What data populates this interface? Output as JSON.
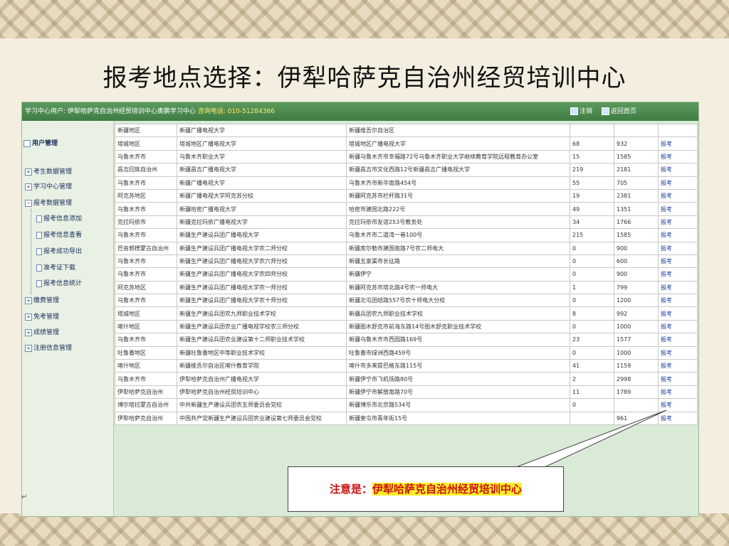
{
  "slide": {
    "title": "报考地点选择：伊犁哈萨克自治州经贸培训中心"
  },
  "topbar": {
    "user_text": "学习中心用户: 伊犁哈萨克自治州经贸培训中心奥鹏学习中心",
    "phone_label": "咨询电话: 010-51284366",
    "logout": "注销",
    "home": "返回首页"
  },
  "sidebar": {
    "header": "用户管理",
    "items": [
      "考生数据管理",
      "学习中心管理",
      "报考数据管理",
      "报考信息添加",
      "报考信息查看",
      "报考成功导出",
      "准考证下载",
      "报考信息统计",
      "缴费管理",
      "免考管理",
      "成绩管理",
      "注册信息管理"
    ]
  },
  "table": {
    "rows": [
      [
        "新疆地区",
        "新疆广播电视大学",
        "新疆维吾尔自治区",
        "",
        "",
        ""
      ],
      [
        "塔城地区",
        "塔城地区广播电视大学",
        "塔城地区广播电视大学",
        "68",
        "932",
        "报考"
      ],
      [
        "乌鲁木齐市",
        "乌鲁木齐职业大学",
        "新疆乌鲁木齐市幸福路72号乌鲁木齐职业大学继续教育学院远程教育办公室",
        "15",
        "1585",
        "报考"
      ],
      [
        "昌吉回族自治州",
        "新疆昌吉广播电视大学",
        "新疆昌吉市文化西路12号新疆昌吉广播电视大学",
        "219",
        "2181",
        "报考"
      ],
      [
        "乌鲁木齐市",
        "新疆广播电视大学",
        "乌鲁木齐市新华南路454号",
        "55",
        "705",
        "报考"
      ],
      [
        "阿克苏地区",
        "新疆广播电视大学阿克苏分校",
        "新疆阿克苏市栏杆路31号",
        "19",
        "2381",
        "报考"
      ],
      [
        "乌鲁木齐市",
        "新疆哈密广播电视大学",
        "哈密市建国北路222号",
        "49",
        "1351",
        "报考"
      ],
      [
        "克拉玛依市",
        "新疆克拉玛依广播电视大学",
        "克拉玛依市友谊253号教务处",
        "34",
        "1766",
        "报考"
      ],
      [
        "乌鲁木齐市",
        "新疆生产建设兵团广播电视大学",
        "乌鲁木齐市二道湾一巷100号",
        "215",
        "1585",
        "报考"
      ],
      [
        "巴音郭楞蒙古自治州",
        "新疆生产建设兵团广播电视大学农二师分校",
        "新疆库尔勒市建国南路7号农二师电大",
        "0",
        "900",
        "报考"
      ],
      [
        "乌鲁木齐市",
        "新疆生产建设兵团广播电视大学农六师分校",
        "新疆五家渠市长征路",
        "0",
        "600",
        "报考"
      ],
      [
        "乌鲁木齐市",
        "新疆生产建设兵团广播电视大学农四师分校",
        "新疆伊宁",
        "0",
        "900",
        "报考"
      ],
      [
        "阿克苏地区",
        "新疆生产建设兵团广播电视大学农一师分校",
        "新疆阿克苏市塔北路4号农一师电大",
        "1",
        "799",
        "报考"
      ],
      [
        "乌鲁木齐市",
        "新疆生产建设兵团广播电视大学农十师分校",
        "新疆北屯团结路557号农十师电大分校",
        "0",
        "1200",
        "报考"
      ],
      [
        "塔城地区",
        "新疆生产建设兵团农九师职业技术学校",
        "新疆兵团农九师职业技术学校",
        "8",
        "992",
        "报考"
      ],
      [
        "喀什地区",
        "新疆生产建设兵团农业广播电视学校农三师分校",
        "新疆图木舒克市前海东路14号图木舒克职业技术学校",
        "0",
        "1000",
        "报考"
      ],
      [
        "乌鲁木齐市",
        "新疆生产建设兵团农业建设第十二师职业技术学校",
        "新疆乌鲁木齐市西园路169号",
        "23",
        "1577",
        "报考"
      ],
      [
        "吐鲁番地区",
        "新疆吐鲁番地区中等职业技术学校",
        "吐鲁番市绿洲西路459号",
        "0",
        "1000",
        "报考"
      ],
      [
        "喀什地区",
        "新疆维吾尔自治区喀什教育学院",
        "喀什市多来提巴格东路115号",
        "41",
        "1159",
        "报考"
      ],
      [
        "乌鲁木齐市",
        "伊犁哈萨克自治州广播电视大学",
        "新疆伊宁市飞机场路80号",
        "2",
        "2998",
        "报考"
      ],
      [
        "伊犁哈萨克自治州",
        "伊犁哈萨克自治州经贸培训中心",
        "新疆伊宁市解放南路70号",
        "11",
        "1789",
        "报考"
      ],
      [
        "博尔塔拉蒙古自治州",
        "中共新疆生产建设兵团农五师委员会党校",
        "新疆博乐市北京路534号",
        "0",
        "",
        "报考"
      ],
      [
        "伊犁哈萨克自治州",
        "中国共产党新疆生产建设兵团农业建设第七师委员会党校",
        "新疆奎屯市青年街15号",
        "",
        "961",
        "报考"
      ]
    ]
  },
  "note": {
    "prefix": "注意是：",
    "highlight": "伊犁哈萨克自治州经贸培训中心"
  },
  "colors": {
    "topbar": "#4a8a4e",
    "panel": "#d9ead6",
    "note_text": "#cc1010",
    "highlight": "#ffef2a"
  }
}
